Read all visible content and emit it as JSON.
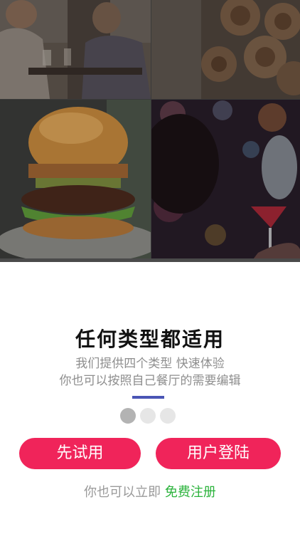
{
  "intro": {
    "headline": "任何类型都适用",
    "subtitle_line1": "我们提供四个类型 快速体验",
    "subtitle_line2": "你也可以按照自己餐厅的需要编辑"
  },
  "pager": {
    "count": 3,
    "active_index": 0
  },
  "buttons": {
    "try_label": "先试用",
    "login_label": "用户登陆"
  },
  "footer": {
    "prefix": "你也可以立即",
    "register_link": "免费注册"
  },
  "colors": {
    "accent": "#4a55b5",
    "button": "#f0245a",
    "link": "#2bb33c"
  },
  "gallery": {
    "tiles": [
      "friends-dining-photo",
      "cinnamon-rolls-photo",
      "burger-photo",
      "cocktail-pour-photo"
    ]
  }
}
